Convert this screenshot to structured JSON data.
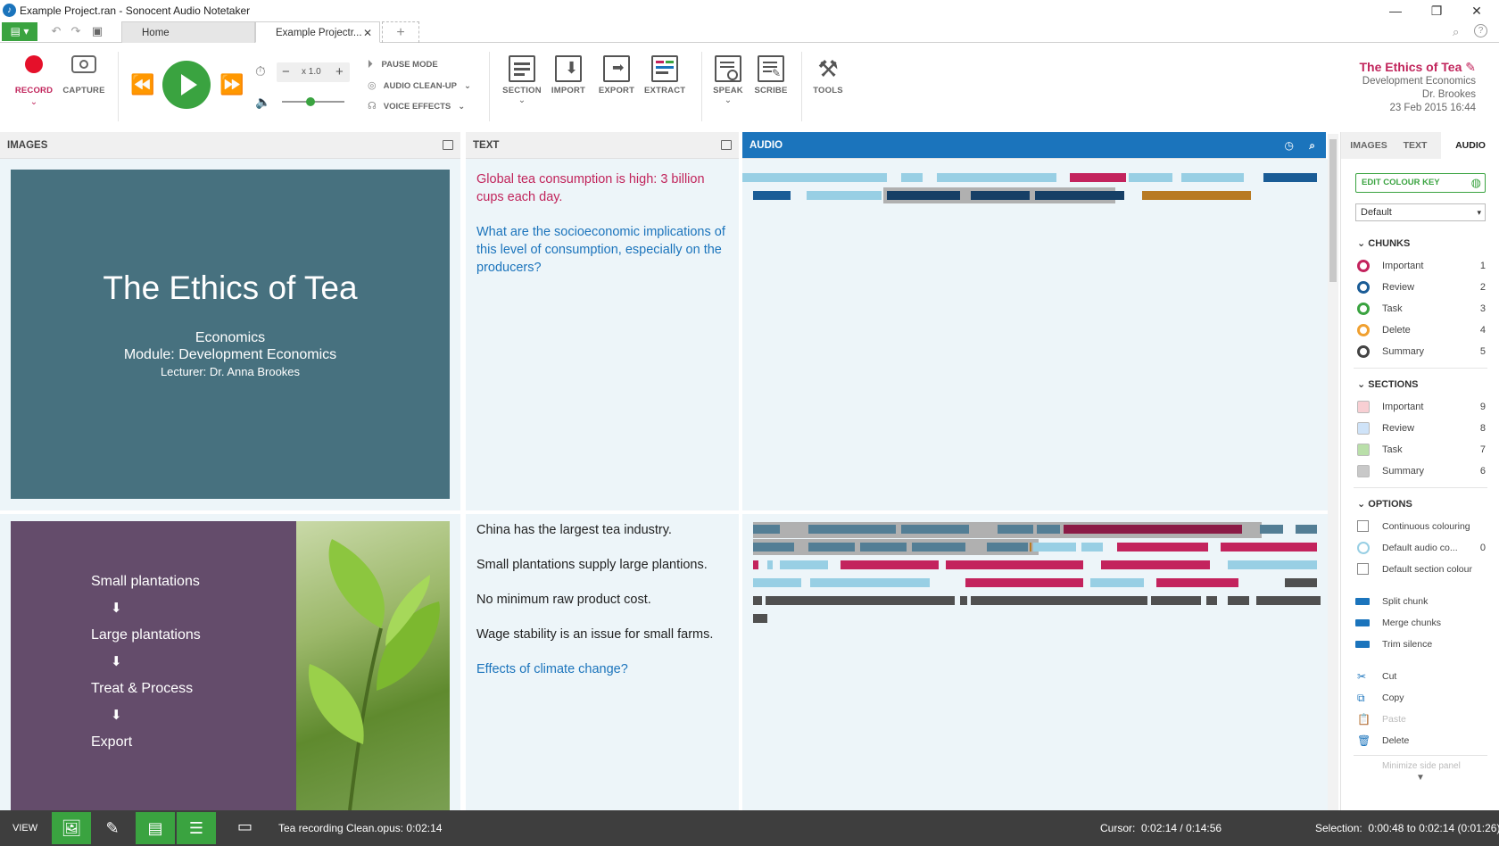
{
  "window": {
    "title": "Example Project.ran - Sonocent Audio Notetaker"
  },
  "tabs": [
    {
      "label": "Home"
    },
    {
      "label": "Example Projectr..."
    }
  ],
  "ribbon": {
    "record": "RECORD",
    "capture": "CAPTURE",
    "speed": "x 1.0",
    "pause_mode": "PAUSE MODE",
    "audio_cleanup": "AUDIO CLEAN-UP",
    "voice_effects": "VOICE EFFECTS",
    "section": "SECTION",
    "import": "IMPORT",
    "export": "EXPORT",
    "extract": "EXTRACT",
    "speak": "SPEAK",
    "scribe": "SCRIBE",
    "tools": "TOOLS",
    "volume_level": 0.45
  },
  "project": {
    "title": "The Ethics of Tea",
    "subject": "Development Economics",
    "lecturer": "Dr. Brookes",
    "date": "23 Feb 2015 16:44"
  },
  "panes": {
    "images": "IMAGES",
    "text": "TEXT",
    "audio": "AUDIO"
  },
  "slide1": {
    "title": "The Ethics of Tea",
    "line1": "Economics",
    "line2": "Module: Development Economics",
    "line3": "Lecturer: Dr. Anna Brookes"
  },
  "slide2": {
    "items": [
      "Small plantations",
      "Large plantations",
      "Treat & Process",
      "Export"
    ]
  },
  "text1": {
    "p1": "Global tea consumption is high: 3 billion cups each day.",
    "p2": "What are the socioeconomic implications of this level of consumption, especially on the producers?"
  },
  "text2": {
    "p1": "China has the largest tea industry.",
    "p2": "Small plantations supply large plantions.",
    "p3": "No minimum raw product cost.",
    "p4": "Wage stability is an issue for small farms.",
    "p5": "Effects of climate change?"
  },
  "side": {
    "tabs": [
      "IMAGES",
      "TEXT",
      "AUDIO"
    ],
    "edit_colour_key": "EDIT COLOUR KEY",
    "dropdown": "Default",
    "chunks_head": "CHUNKS",
    "chunks": [
      {
        "label": "Important",
        "n": "1",
        "color": "#c3235d"
      },
      {
        "label": "Review",
        "n": "2",
        "color": "#1a5c96"
      },
      {
        "label": "Task",
        "n": "3",
        "color": "#3aa340"
      },
      {
        "label": "Delete",
        "n": "4",
        "color": "#f0a030"
      },
      {
        "label": "Summary",
        "n": "5",
        "color": "#444444"
      }
    ],
    "sections_head": "SECTIONS",
    "sections": [
      {
        "label": "Important",
        "n": "9",
        "color": "#f8cfd3"
      },
      {
        "label": "Review",
        "n": "8",
        "color": "#cfe3f8"
      },
      {
        "label": "Task",
        "n": "7",
        "color": "#b9dfa9"
      },
      {
        "label": "Summary",
        "n": "6",
        "color": "#c8c8c8"
      }
    ],
    "options_head": "OPTIONS",
    "options": [
      {
        "label": "Continuous colouring"
      },
      {
        "label": "Default audio co...",
        "n": "0"
      },
      {
        "label": "Default section colour"
      }
    ],
    "actions1": [
      "Split chunk",
      "Merge chunks",
      "Trim silence"
    ],
    "actions2": [
      "Cut",
      "Copy",
      "Paste",
      "Delete"
    ],
    "minimize": "Minimize side panel"
  },
  "status": {
    "view": "VIEW",
    "file": "Tea recording Clean.opus: 0:02:14",
    "cursor": "Cursor:  0:02:14 / 0:14:56",
    "selection": "Selection:  0:00:48 to 0:02:14 (0:01:26)"
  }
}
